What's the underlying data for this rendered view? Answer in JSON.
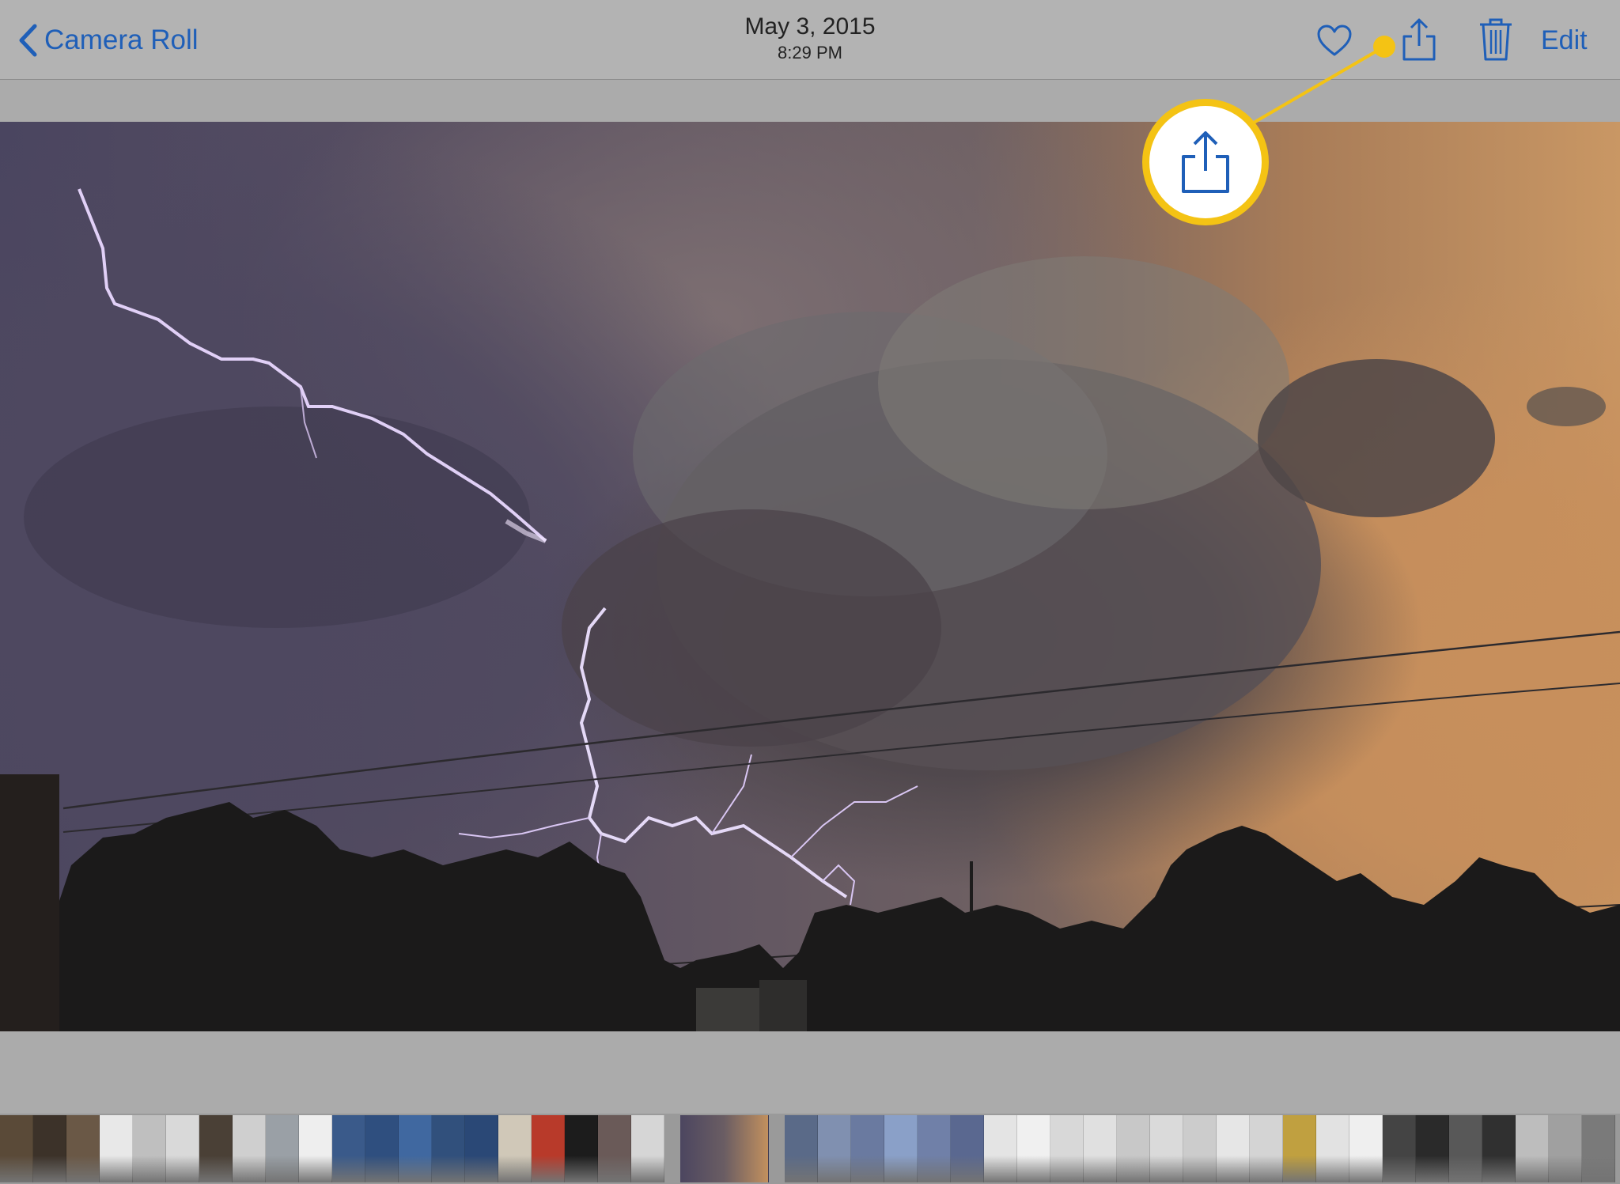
{
  "navbar": {
    "back_label": "Camera Roll",
    "title_date": "May 3, 2015",
    "title_time": "8:29 PM",
    "edit_label": "Edit",
    "icons": [
      "chevron-left-icon",
      "heart-icon",
      "share-icon",
      "trash-icon"
    ]
  },
  "callout": {
    "color": "#f4c314",
    "target": "share-icon"
  },
  "colors": {
    "accent": "#1f5fb8",
    "highlight": "#f4c314"
  },
  "thumbnails": {
    "current_index": 20,
    "count": 46
  }
}
